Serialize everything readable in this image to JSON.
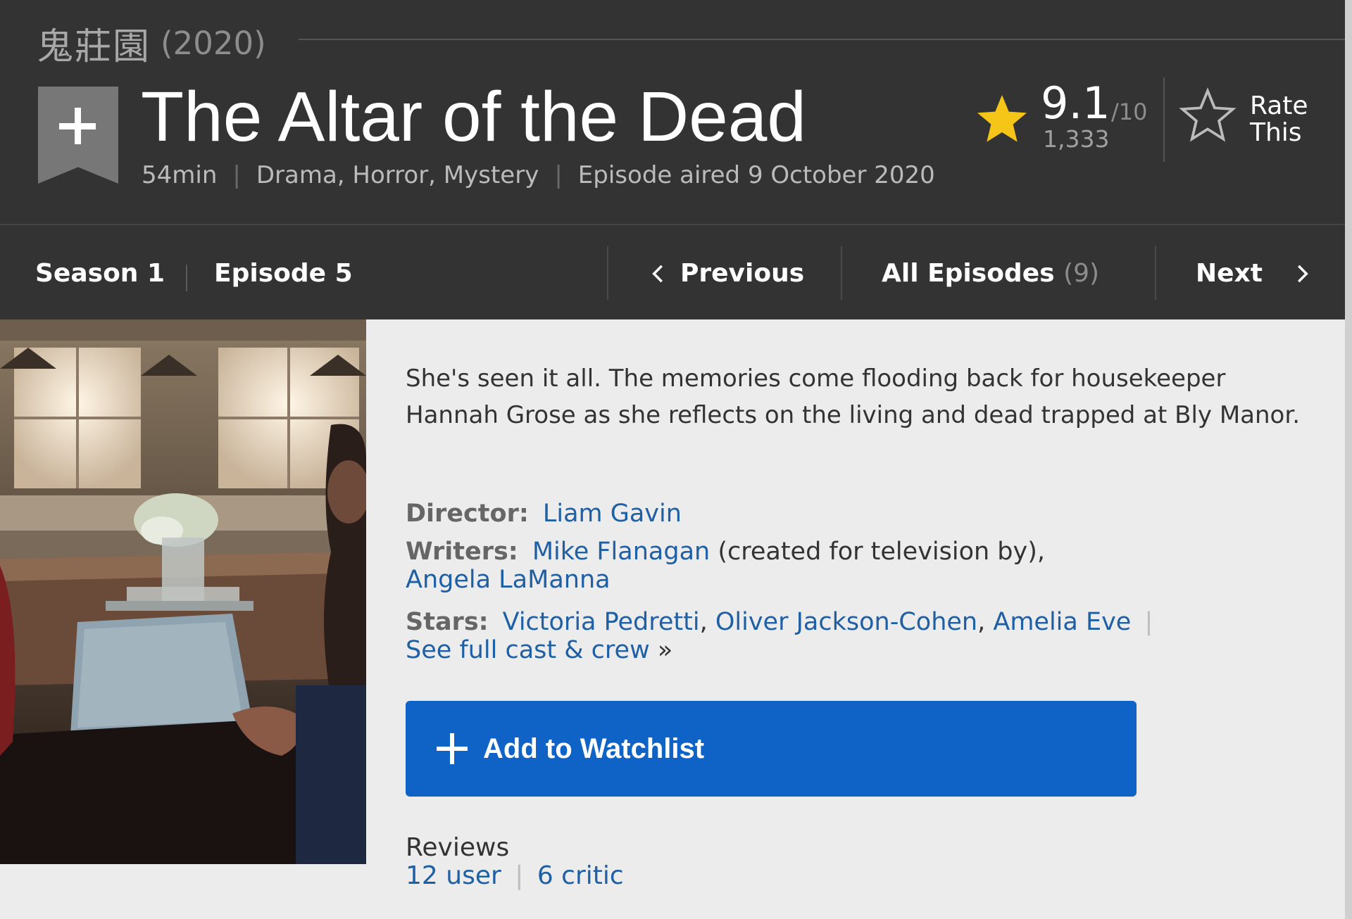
{
  "series": {
    "title": "鬼莊園",
    "year": "(2020)"
  },
  "episode": {
    "title": "The Altar of the Dead",
    "runtime": "54min",
    "genres": "Drama, Horror, Mystery",
    "air_info": "Episode aired 9 October 2020",
    "separator": "|"
  },
  "rating": {
    "value": "9.1",
    "best": "/10",
    "count": "1,333",
    "rate_line1": "Rate",
    "rate_line2": "This",
    "star_color": "#f5c518"
  },
  "nav": {
    "season": "Season 1",
    "episode": "Episode 5",
    "previous": "Previous",
    "all_episodes": "All Episodes",
    "all_episodes_count": "(9)",
    "next": "Next",
    "separator": "|"
  },
  "plot": "She's seen it all. The memories come flooding back for housekeeper Hannah Grose as she reflects on the living and dead trapped at Bly Manor.",
  "credits": {
    "director_label": "Director:",
    "director": "Liam Gavin",
    "writers_label": "Writers:",
    "writer1": "Mike Flanagan",
    "writer1_note": " (created for television by),",
    "writer2": "Angela LaManna",
    "stars_label": "Stars:",
    "star1": "Victoria Pedretti",
    "star2": "Oliver Jackson-Cohen",
    "star3": "Amelia Eve",
    "comma": ",",
    "pipe": "|",
    "full_cast": "See full cast & crew",
    "full_cast_arrow": "»"
  },
  "watchlist_button": "Add to Watchlist",
  "reviews": {
    "label": "Reviews",
    "user": "12 user",
    "critic": "6 critic",
    "separator": "|"
  },
  "colors": {
    "header_bg": "#333333",
    "page_bg": "#ececec",
    "link": "#1f5fa4",
    "button": "#0f63c7"
  },
  "icons": {
    "watchlist_ribbon": "bookmark-plus-icon",
    "rating_star": "star-filled-icon",
    "rate_star": "star-outline-icon",
    "prev": "chevron-left-icon",
    "next": "chevron-right-icon",
    "button_plus": "plus-icon"
  }
}
